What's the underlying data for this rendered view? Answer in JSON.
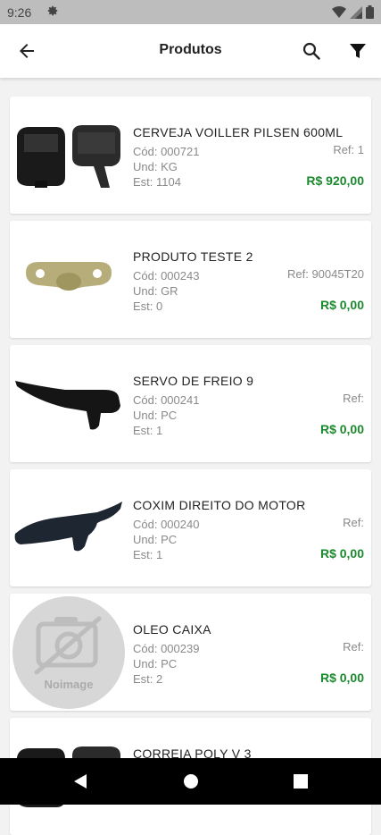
{
  "status_bar": {
    "time": "9:26"
  },
  "app_bar": {
    "title": "Produtos"
  },
  "labels": {
    "code_prefix": "Cód: ",
    "unit_prefix": "Und: ",
    "stock_prefix": "Est: ",
    "ref_prefix": "Ref: ",
    "noimage_text": "Noimage"
  },
  "products": [
    {
      "name": "CERVEJA VOILLER PILSEN 600ML",
      "code": "Cód: 000721",
      "unit": "Und: KG",
      "stock": "Est: 1104",
      "ref": "Ref: 1",
      "price": "R$ 920,00",
      "image": "remote-cover-black"
    },
    {
      "name": "PRODUTO TESTE 2",
      "code": "Cód: 000243",
      "unit": "Und: GR",
      "stock": "Est: 0",
      "ref": "Ref: 90045T20",
      "price": "R$ 0,00",
      "image": "bracket-beige"
    },
    {
      "name": "SERVO DE FREIO 9",
      "code": "Cód: 000241",
      "unit": "Und: PC",
      "stock": "Est: 1",
      "ref": "Ref:",
      "price": "R$ 0,00",
      "image": "door-handle-black"
    },
    {
      "name": "COXIM DIREITO DO MOTOR",
      "code": "Cód: 000240",
      "unit": "Und: PC",
      "stock": "Est: 1",
      "ref": "Ref:",
      "price": "R$ 0,00",
      "image": "door-handle-black"
    },
    {
      "name": "OLEO CAIXA",
      "code": "Cód: 000239",
      "unit": "Und: PC",
      "stock": "Est: 2",
      "ref": "Ref:",
      "price": "R$ 0,00",
      "image": "noimage-placeholder"
    },
    {
      "name": "CORREIA POLY V 3",
      "image": "remote-cover-black"
    }
  ],
  "colors": {
    "price_green": "#1b8a2e",
    "background": "#f2f2f2",
    "status_bar": "#bdbdbd"
  }
}
